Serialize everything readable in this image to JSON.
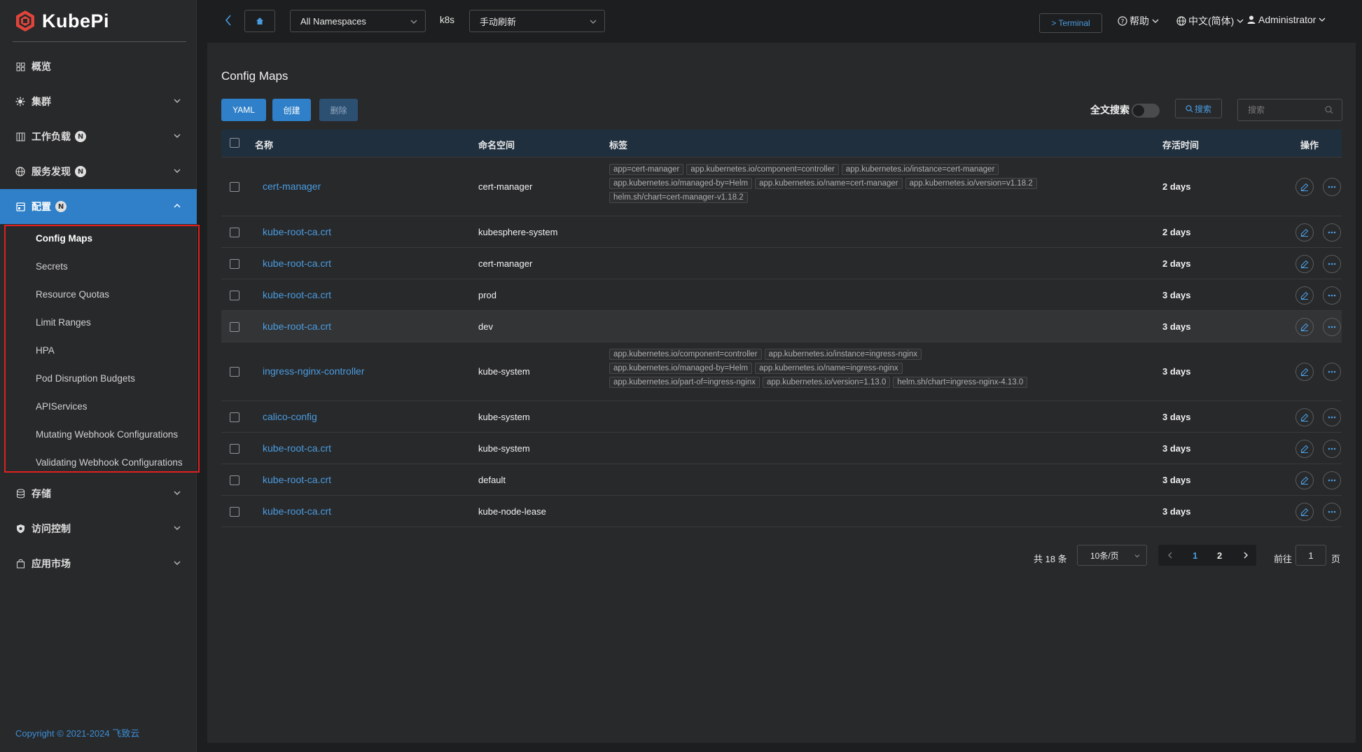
{
  "app": {
    "name": "KubePi",
    "copyright": "Copyright © 2021-2024 飞致云"
  },
  "sidebar": {
    "items": [
      {
        "label": "概览",
        "icon": "dashboard-icon",
        "has_chevron": false
      },
      {
        "label": "集群",
        "icon": "cluster-icon",
        "has_chevron": true
      },
      {
        "label": "工作负载",
        "icon": "workload-icon",
        "badge": "N",
        "has_chevron": true
      },
      {
        "label": "服务发现",
        "icon": "globe-icon",
        "badge": "N",
        "has_chevron": true
      },
      {
        "label": "配置",
        "icon": "config-icon",
        "badge": "N",
        "has_chevron": true,
        "active": true
      },
      {
        "label": "存储",
        "icon": "database-icon",
        "has_chevron": true
      },
      {
        "label": "访问控制",
        "icon": "shield-icon",
        "has_chevron": true
      },
      {
        "label": "应用市场",
        "icon": "bag-icon",
        "has_chevron": true
      }
    ],
    "submenu": [
      "Config Maps",
      "Secrets",
      "Resource Quotas",
      "Limit Ranges",
      "HPA",
      "Pod Disruption Budgets",
      "APIServices",
      "Mutating Webhook Configurations",
      "Validating Webhook Configurations"
    ],
    "submenu_current": "Config Maps"
  },
  "topbar": {
    "namespace": "All Namespaces",
    "cluster": "k8s",
    "refresh": "手动刷新",
    "terminal": "Terminal",
    "help": "帮助",
    "language": "中文(简体)",
    "user": "Administrator"
  },
  "page": {
    "title": "Config Maps",
    "buttons": {
      "yaml": "YAML",
      "create": "创建",
      "delete": "删除"
    },
    "full_text_search": "全文搜索",
    "full_text_search_on": false,
    "search_button": "搜索",
    "search_placeholder": "搜索"
  },
  "table": {
    "headers": {
      "name": "名称",
      "namespace": "命名空间",
      "labels": "标签",
      "age": "存活时间",
      "actions": "操作"
    },
    "rows": [
      {
        "name": "cert-manager",
        "namespace": "cert-manager",
        "labels": [
          "app=cert-manager",
          "app.kubernetes.io/component=controller",
          "app.kubernetes.io/instance=cert-manager",
          "app.kubernetes.io/managed-by=Helm",
          "app.kubernetes.io/name=cert-manager",
          "app.kubernetes.io/version=v1.18.2",
          "helm.sh/chart=cert-manager-v1.18.2"
        ],
        "age": "2 days"
      },
      {
        "name": "kube-root-ca.crt",
        "namespace": "kubesphere-system",
        "labels": [],
        "age": "2 days"
      },
      {
        "name": "kube-root-ca.crt",
        "namespace": "cert-manager",
        "labels": [],
        "age": "2 days"
      },
      {
        "name": "kube-root-ca.crt",
        "namespace": "prod",
        "labels": [],
        "age": "3 days"
      },
      {
        "name": "kube-root-ca.crt",
        "namespace": "dev",
        "labels": [],
        "age": "3 days"
      },
      {
        "name": "ingress-nginx-controller",
        "namespace": "kube-system",
        "labels": [
          "app.kubernetes.io/component=controller",
          "app.kubernetes.io/instance=ingress-nginx",
          "app.kubernetes.io/managed-by=Helm",
          "app.kubernetes.io/name=ingress-nginx",
          "app.kubernetes.io/part-of=ingress-nginx",
          "app.kubernetes.io/version=1.13.0",
          "helm.sh/chart=ingress-nginx-4.13.0"
        ],
        "age": "3 days"
      },
      {
        "name": "calico-config",
        "namespace": "kube-system",
        "labels": [],
        "age": "3 days"
      },
      {
        "name": "kube-root-ca.crt",
        "namespace": "kube-system",
        "labels": [],
        "age": "3 days"
      },
      {
        "name": "kube-root-ca.crt",
        "namespace": "default",
        "labels": [],
        "age": "3 days"
      },
      {
        "name": "kube-root-ca.crt",
        "namespace": "kube-node-lease",
        "labels": [],
        "age": "3 days"
      }
    ]
  },
  "pagination": {
    "total": "共 18 条",
    "page_size": "10条/页",
    "pages": [
      "1",
      "2"
    ],
    "current": "1",
    "goto_label": "前往",
    "goto_value": "1",
    "goto_suffix": "页"
  },
  "colors": {
    "accent": "#2f80c9",
    "link": "#4a9ce0",
    "highlight_border": "#e02020"
  }
}
